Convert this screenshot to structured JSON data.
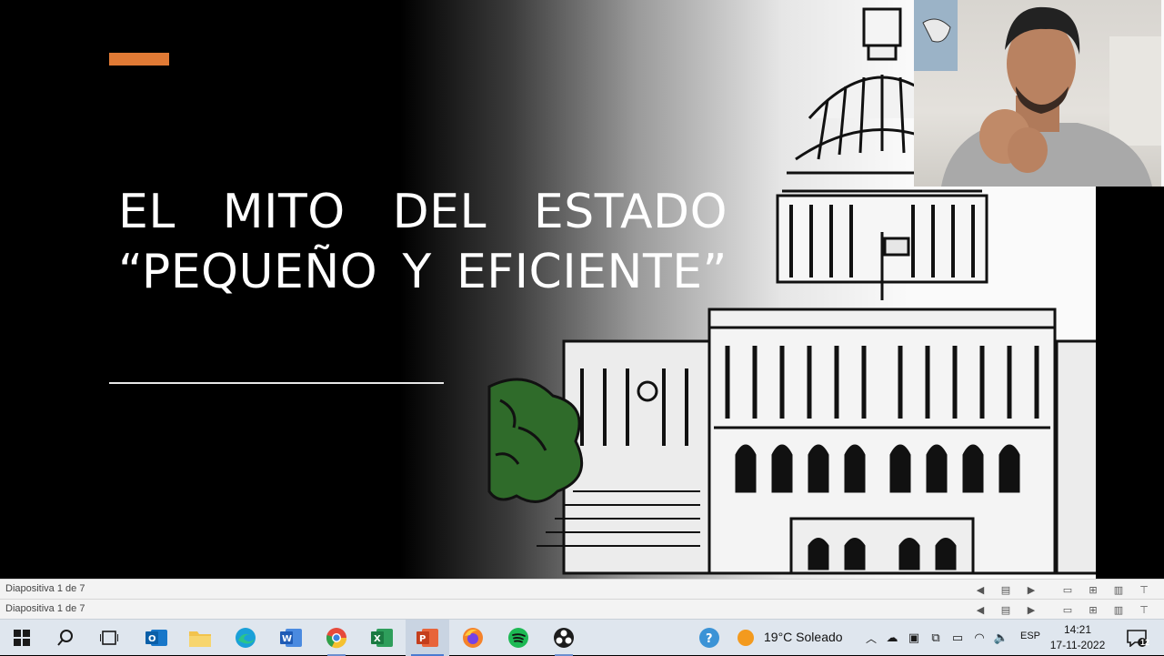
{
  "slide": {
    "title_line1": "EL MITO DEL ESTADO",
    "title_line2": "“PEQUEÑO Y EFICIENTE”",
    "accent_color": "#e07a35"
  },
  "statusbars": [
    {
      "label": "Diapositiva 1 de 7"
    },
    {
      "label": "Diapositiva 1 de 7"
    }
  ],
  "taskbar": {
    "apps": [
      {
        "name": "Windows Start",
        "icon": "windows-icon"
      },
      {
        "name": "Search",
        "icon": "search-icon"
      },
      {
        "name": "Task View",
        "icon": "task-view-icon"
      },
      {
        "name": "Outlook",
        "icon": "outlook-icon"
      },
      {
        "name": "File Explorer",
        "icon": "folder-icon"
      },
      {
        "name": "Edge",
        "icon": "edge-icon"
      },
      {
        "name": "Word",
        "icon": "word-icon"
      },
      {
        "name": "Chrome",
        "icon": "chrome-icon"
      },
      {
        "name": "Excel",
        "icon": "excel-icon"
      },
      {
        "name": "PowerPoint",
        "icon": "powerpoint-icon"
      },
      {
        "name": "Firefox",
        "icon": "firefox-icon"
      },
      {
        "name": "Spotify",
        "icon": "spotify-icon"
      },
      {
        "name": "OBS",
        "icon": "obs-icon"
      }
    ],
    "weather": "19°C  Soleado",
    "language": "ESP",
    "time": "14:21",
    "date": "17-11-2022",
    "notifications": "12"
  }
}
